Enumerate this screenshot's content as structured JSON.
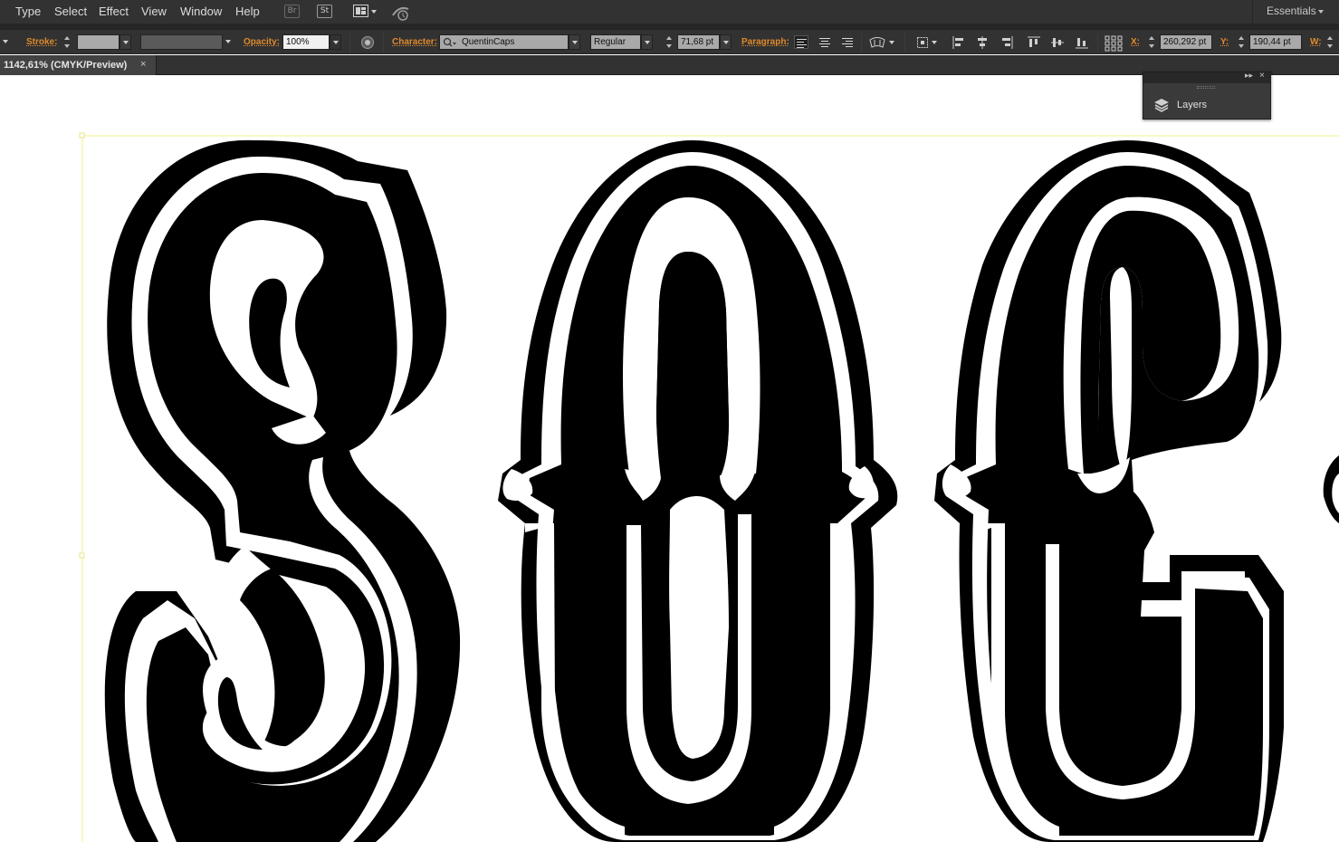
{
  "menubar": {
    "items": [
      "Type",
      "Select",
      "Effect",
      "View",
      "Window",
      "Help"
    ],
    "bridge_icon": "Br",
    "stock_icon": "St",
    "workspace": "Essentials"
  },
  "controlbar": {
    "stroke_label": "Stroke:",
    "opacity_label": "Opacity:",
    "opacity_value": "100%",
    "character_label": "Character:",
    "font_family": "QuentinCaps",
    "font_style": "Regular",
    "font_size": "71,68 pt",
    "paragraph_label": "Paragraph:",
    "x_label": "X:",
    "x_value": "260,292 pt",
    "y_label": "Y:",
    "y_value": "190,44 pt",
    "w_label": "W:"
  },
  "document": {
    "tab_title": "1142,61% (CMYK/Preview)",
    "close_glyph": "×"
  },
  "layers_panel": {
    "label": "Layers",
    "collapse_glyph": "▸▸",
    "close_glyph": "×",
    "icon": "layers-icon"
  },
  "colors": {
    "ui_background": "#323232",
    "accent_label": "#e08a2c",
    "artboard_guide": "#f0f08a",
    "artwork_fill": "#000000"
  }
}
